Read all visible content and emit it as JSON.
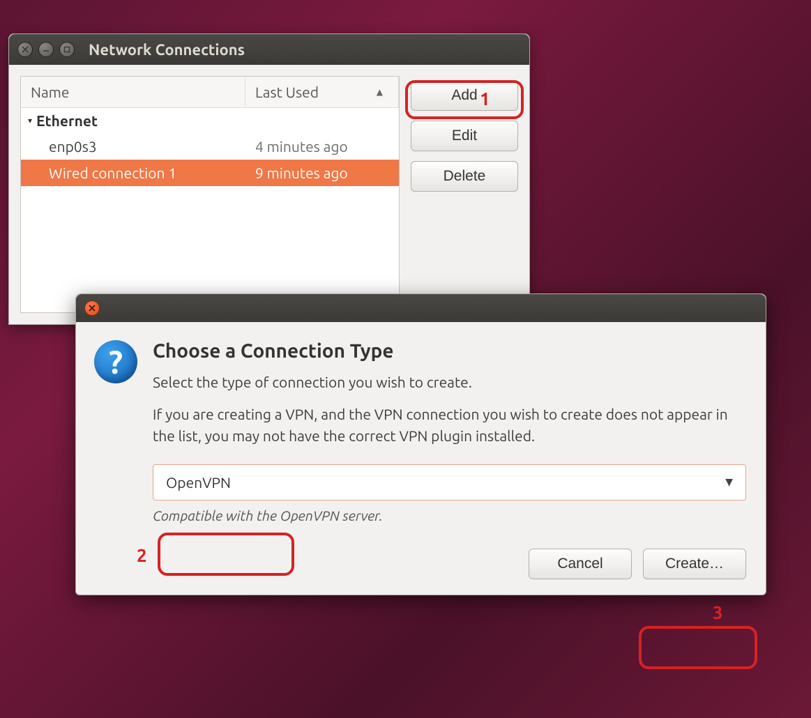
{
  "window1": {
    "title": "Network Connections",
    "columns": {
      "name": "Name",
      "last_used": "Last Used"
    },
    "group": "Ethernet",
    "rows": [
      {
        "name": "enp0s3",
        "last_used": "4 minutes ago",
        "selected": false
      },
      {
        "name": "Wired connection 1",
        "last_used": "9 minutes ago",
        "selected": true
      }
    ],
    "buttons": {
      "add": "Add",
      "edit": "Edit",
      "delete": "Delete"
    }
  },
  "window2": {
    "title": "Choose a Connection Type",
    "text1": "Select the type of connection you wish to create.",
    "text2": "If you are creating a VPN, and the VPN connection you wish to create does not appear in the list, you may not have the correct VPN plugin installed.",
    "combo_value": "OpenVPN",
    "compat": "Compatible with the OpenVPN server.",
    "buttons": {
      "cancel": "Cancel",
      "create": "Create…"
    }
  },
  "annotations": {
    "step1": "1",
    "step2": "2",
    "step3": "3"
  }
}
